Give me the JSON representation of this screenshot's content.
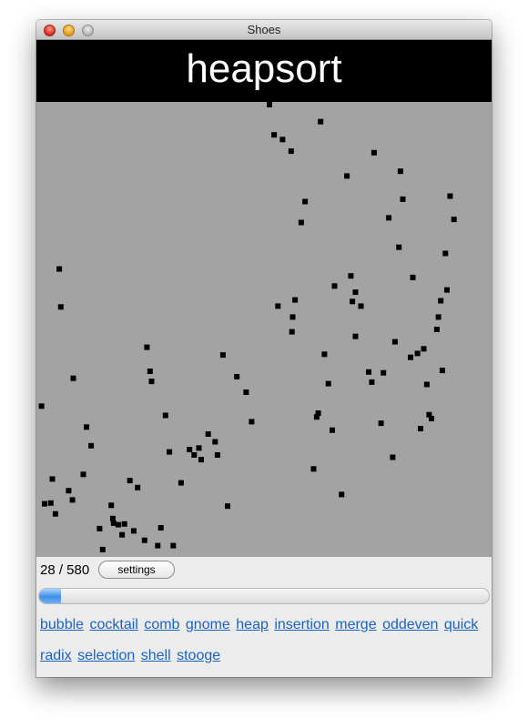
{
  "window": {
    "title": "Shoes"
  },
  "banner": {
    "title": "heapsort"
  },
  "status": {
    "current": 28,
    "total": 580,
    "counter_text": "28 / 580",
    "settings_label": "settings",
    "progress_fraction": 0.0483
  },
  "algorithms": [
    "bubble",
    "cocktail",
    "comb",
    "gnome",
    "heap",
    "insertion",
    "merge",
    "oddeven",
    "quick",
    "radix",
    "selection",
    "shell",
    "stooge"
  ],
  "colors": {
    "canvas_background": "#a3a3a3",
    "dot": "#000000",
    "banner_background": "#000000",
    "banner_text": "#ffffff",
    "link": "#1a63c8",
    "progress_fill": "#3f8fe6"
  },
  "chart_data": {
    "type": "scatter",
    "xlim": [
      0,
      580
    ],
    "ylim": [
      0,
      580
    ],
    "points": [
      [
        3,
        191
      ],
      [
        7,
        65
      ],
      [
        15,
        66
      ],
      [
        17,
        97
      ],
      [
        21,
        52
      ],
      [
        26,
        368
      ],
      [
        28,
        319
      ],
      [
        38,
        82
      ],
      [
        43,
        70
      ],
      [
        44,
        227
      ],
      [
        57,
        103
      ],
      [
        61,
        164
      ],
      [
        67,
        140
      ],
      [
        78,
        33
      ],
      [
        82,
        6
      ],
      [
        93,
        63
      ],
      [
        95,
        46
      ],
      [
        96,
        40
      ],
      [
        102,
        38
      ],
      [
        107,
        25
      ],
      [
        110,
        39
      ],
      [
        117,
        95
      ],
      [
        122,
        30
      ],
      [
        127,
        86
      ],
      [
        136,
        18
      ],
      [
        139,
        267
      ],
      [
        143,
        236
      ],
      [
        145,
        223
      ],
      [
        153,
        11
      ],
      [
        157,
        34
      ],
      [
        163,
        179
      ],
      [
        168,
        132
      ],
      [
        173,
        11
      ],
      [
        183,
        92
      ],
      [
        194,
        135
      ],
      [
        200,
        128
      ],
      [
        206,
        137
      ],
      [
        209,
        122
      ],
      [
        218,
        155
      ],
      [
        227,
        145
      ],
      [
        230,
        128
      ],
      [
        237,
        257
      ],
      [
        243,
        62
      ],
      [
        255,
        229
      ],
      [
        267,
        209
      ],
      [
        274,
        171
      ],
      [
        297,
        582
      ],
      [
        303,
        541
      ],
      [
        308,
        320
      ],
      [
        314,
        535
      ],
      [
        325,
        520
      ],
      [
        326,
        287
      ],
      [
        327,
        306
      ],
      [
        330,
        328
      ],
      [
        338,
        428
      ],
      [
        343,
        455
      ],
      [
        354,
        110
      ],
      [
        358,
        177
      ],
      [
        360,
        182
      ],
      [
        363,
        558
      ],
      [
        368,
        258
      ],
      [
        373,
        220
      ],
      [
        378,
        160
      ],
      [
        381,
        346
      ],
      [
        390,
        77
      ],
      [
        397,
        488
      ],
      [
        402,
        359
      ],
      [
        404,
        326
      ],
      [
        408,
        281
      ],
      [
        408,
        338
      ],
      [
        415,
        320
      ],
      [
        425,
        235
      ],
      [
        429,
        222
      ],
      [
        432,
        518
      ],
      [
        441,
        169
      ],
      [
        444,
        234
      ],
      [
        451,
        434
      ],
      [
        456,
        125
      ],
      [
        459,
        274
      ],
      [
        464,
        396
      ],
      [
        466,
        494
      ],
      [
        469,
        458
      ],
      [
        479,
        254
      ],
      [
        482,
        357
      ],
      [
        488,
        259
      ],
      [
        492,
        162
      ],
      [
        496,
        265
      ],
      [
        500,
        219
      ],
      [
        503,
        180
      ],
      [
        506,
        175
      ],
      [
        513,
        290
      ],
      [
        515,
        306
      ],
      [
        518,
        327
      ],
      [
        520,
        237
      ],
      [
        524,
        388
      ],
      [
        526,
        341
      ],
      [
        530,
        462
      ],
      [
        535,
        432
      ]
    ]
  }
}
